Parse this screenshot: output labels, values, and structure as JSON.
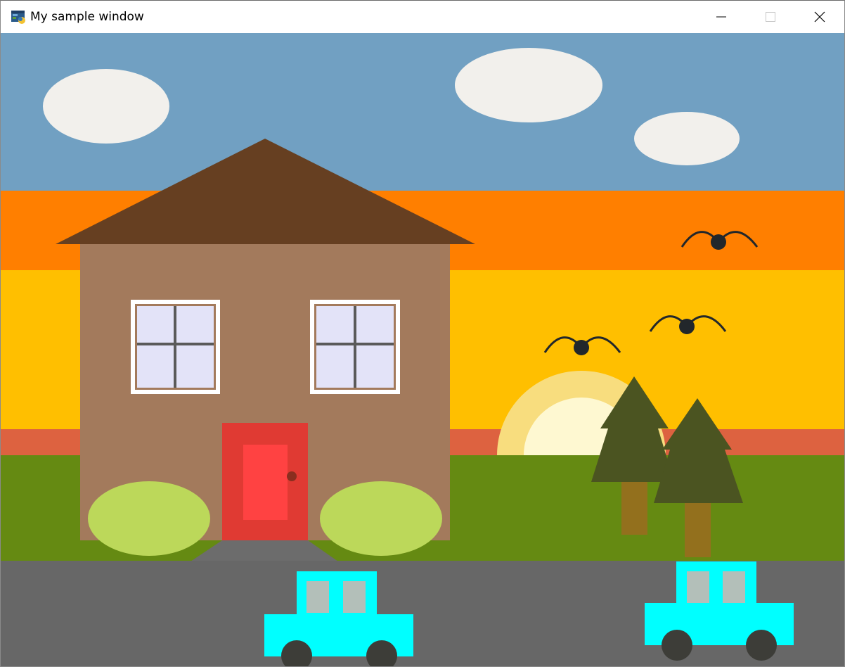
{
  "window": {
    "title": "My sample window",
    "controls": {
      "minimize": "minimize-icon",
      "maximize": "maximize-icon",
      "close": "close-icon"
    }
  },
  "scene": {
    "colors": {
      "sky": "#71A0C2",
      "sunset_orange": "#FF7F00",
      "sunset_yellow": "#FFBF00",
      "horizon_red": "#DD6240",
      "grass": "#658A12",
      "road": "#676767",
      "cloud": "#F2F0EC",
      "roof": "#663F21",
      "house_wall": "#A37A5C",
      "window_frame": "#FFFFFF",
      "window_glass": "#E3E3F8",
      "window_bars": "#5A5A5A",
      "door_frame": "#E03A33",
      "door_panel": "#FF4242",
      "door_knob": "#8A2E1F",
      "bush": "#BCD85A",
      "walkway": "#6C6C6C",
      "sun_outer": "#F8DD7E",
      "sun_inner": "#FEF8D1",
      "tree_foliage": "#4B5421",
      "tree_trunk": "#93701D",
      "bird": "#22272B",
      "car_body": "#00FFFF",
      "car_window": "#B3BFB9",
      "car_wheel": "#3D3D38"
    },
    "elements": [
      "clouds",
      "house",
      "sun",
      "birds",
      "trees",
      "road",
      "cars"
    ]
  }
}
